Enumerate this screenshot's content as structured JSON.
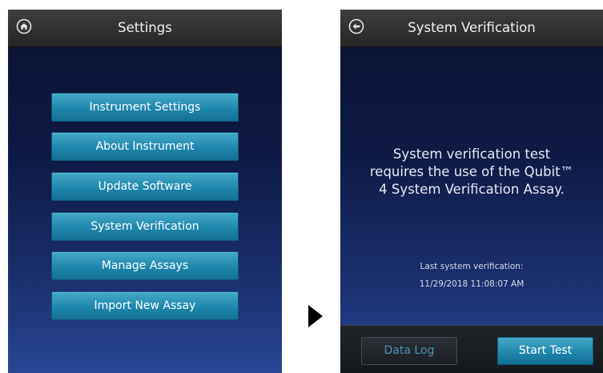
{
  "settings_screen": {
    "title": "Settings",
    "menu": [
      {
        "label": "Instrument Settings"
      },
      {
        "label": "About Instrument"
      },
      {
        "label": "Update Software"
      },
      {
        "label": "System Verification"
      },
      {
        "label": "Manage Assays"
      },
      {
        "label": "Import New Assay"
      }
    ]
  },
  "verification_screen": {
    "title": "System Verification",
    "message_lines": [
      "System verification test",
      "requires the use of the Qubit™",
      "4 System Verification Assay."
    ],
    "last_verification_label": "Last system verification:",
    "last_verification_value": "11/29/2018 11:08:07 AM",
    "data_log_label": "Data Log",
    "start_test_label": "Start Test"
  },
  "colors": {
    "accent": "#1f87ad",
    "topbar": "#2f2f2f",
    "background": "#0e1a45"
  },
  "icons": {
    "home": "home-icon",
    "back": "back-arrow-icon",
    "transition": "right-arrow-icon"
  }
}
